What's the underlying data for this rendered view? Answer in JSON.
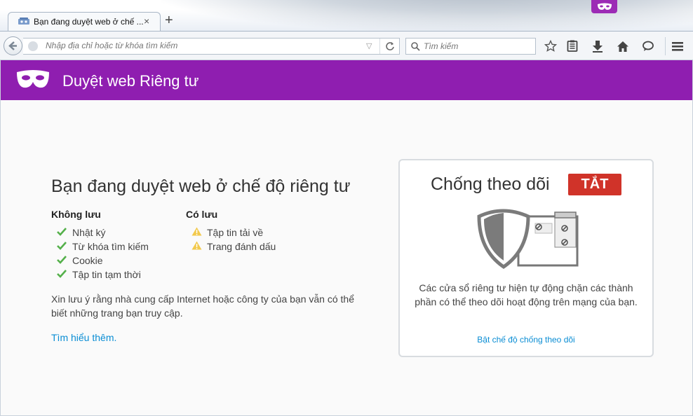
{
  "tab": {
    "title": "Bạn đang duyệt web ở chế ...",
    "close": "×",
    "new_tab": "+"
  },
  "navbar": {
    "url_placeholder": "Nhập địa chỉ hoặc từ khóa tìm kiếm",
    "search_placeholder": "Tìm kiếm"
  },
  "banner": {
    "title": "Duyệt web Riêng tư",
    "color": "#8f1eb0"
  },
  "main": {
    "title": "Bạn đang duyệt web ở chế độ riêng tư",
    "not_saved": {
      "heading": "Không lưu",
      "items": [
        "Nhật ký",
        "Từ khóa tìm kiếm",
        "Cookie",
        "Tập tin tạm thời"
      ]
    },
    "saved": {
      "heading": "Có lưu",
      "items": [
        "Tập tin tải về",
        "Trang đánh dấu"
      ]
    },
    "note": "Xin lưu ý rằng nhà cung cấp Internet hoặc công ty của bạn vẫn có thể biết những trang bạn truy cập.",
    "learn_more": "Tìm hiểu thêm."
  },
  "tracking": {
    "title": "Chống theo dõi",
    "toggle_label": "TẮT",
    "toggle_color": "#d03329",
    "description": "Các cửa sổ riêng tư hiện tự động chặn các thành phần có thể theo dõi hoạt động trên mạng của bạn.",
    "enable_link": "Bật chế độ chống theo dõi"
  },
  "icons": {
    "check": "check-icon",
    "warning": "warning-icon",
    "mask": "private-mask-icon"
  }
}
